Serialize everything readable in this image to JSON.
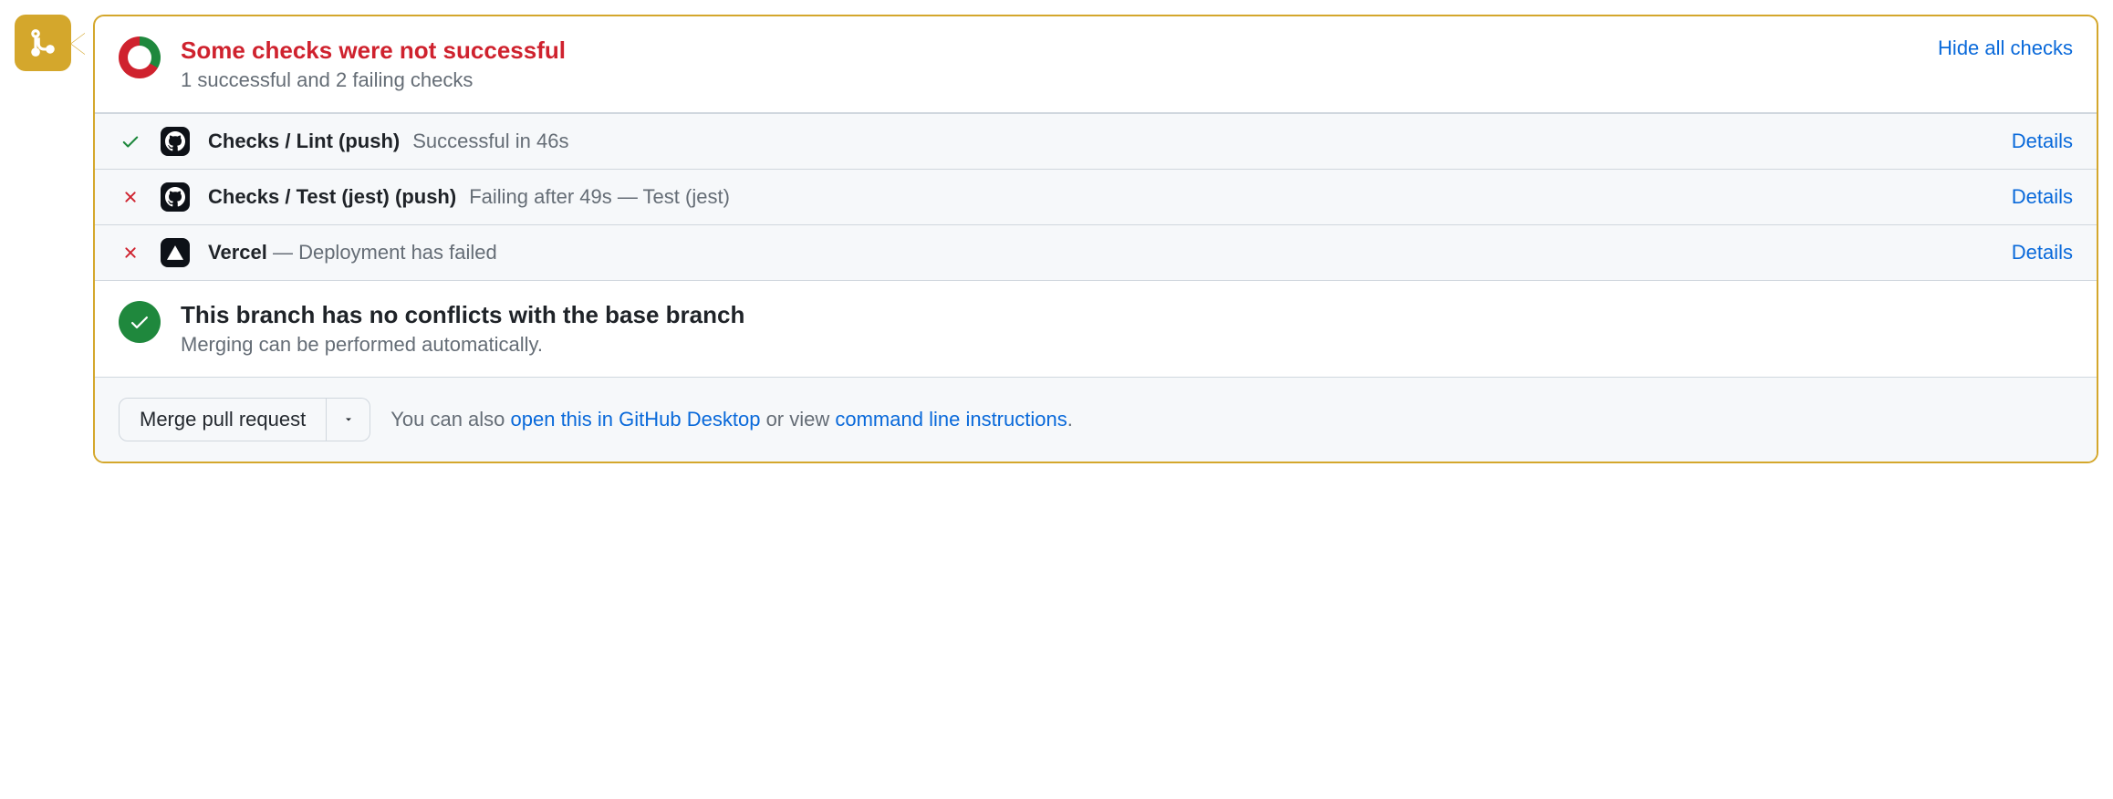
{
  "header": {
    "title": "Some checks were not successful",
    "subtitle": "1 successful and 2 failing checks",
    "toggle": "Hide all checks"
  },
  "checks": [
    {
      "status": "success",
      "app": "github",
      "name": "Checks / Lint (push)",
      "desc": "Successful in 46s",
      "link": "Details"
    },
    {
      "status": "fail",
      "app": "github",
      "name": "Checks / Test (jest) (push)",
      "desc": "Failing after 49s — Test (jest)",
      "link": "Details"
    },
    {
      "status": "fail",
      "app": "vercel",
      "name": "Vercel",
      "desc": " — Deployment has failed",
      "link": "Details",
      "inline": true
    }
  ],
  "conflict": {
    "title": "This branch has no conflicts with the base branch",
    "subtitle": "Merging can be performed automatically."
  },
  "footer": {
    "merge_label": "Merge pull request",
    "text_pre": "You can also ",
    "link1": "open this in GitHub Desktop",
    "text_mid": " or view ",
    "link2": "command line instructions",
    "text_post": "."
  }
}
